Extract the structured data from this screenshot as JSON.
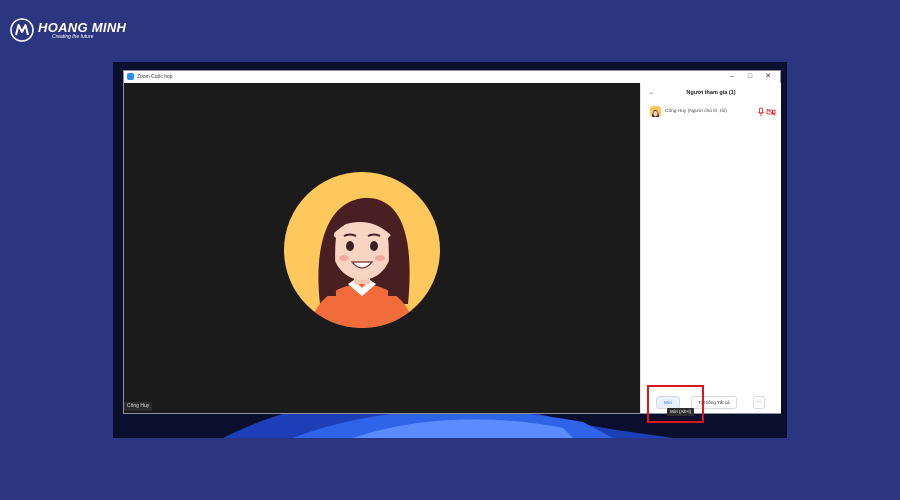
{
  "brand": {
    "name": "HOANG MINH",
    "tagline": "Creating the future",
    "logo_icon": "hoang-minh-logo-icon"
  },
  "window": {
    "title": "Zoom Cuộc họp",
    "controls": {
      "minimize": "–",
      "maximize": "□",
      "close": "✕"
    }
  },
  "video": {
    "participant_label": "Công Huy"
  },
  "participants_panel": {
    "title": "Người tham gia (1)",
    "collapse_icon": "chevron-down-icon",
    "items": [
      {
        "name": "Công Huy (Người chủ trì, tôi)",
        "mic_icon": "mic-muted-icon",
        "video_icon": "video-off-icon"
      }
    ],
    "buttons": {
      "invite": "Mời",
      "mute_all": "Tắt tiếng Tất cả",
      "more": "..."
    },
    "tooltip": "Mời (Alt+I)"
  },
  "colors": {
    "page_background": "#2b3580",
    "highlight": "#e2141b",
    "zoom_blue": "#2d8cff",
    "video_background": "#1b1b1b",
    "avatar_background": "#ffc85c"
  }
}
